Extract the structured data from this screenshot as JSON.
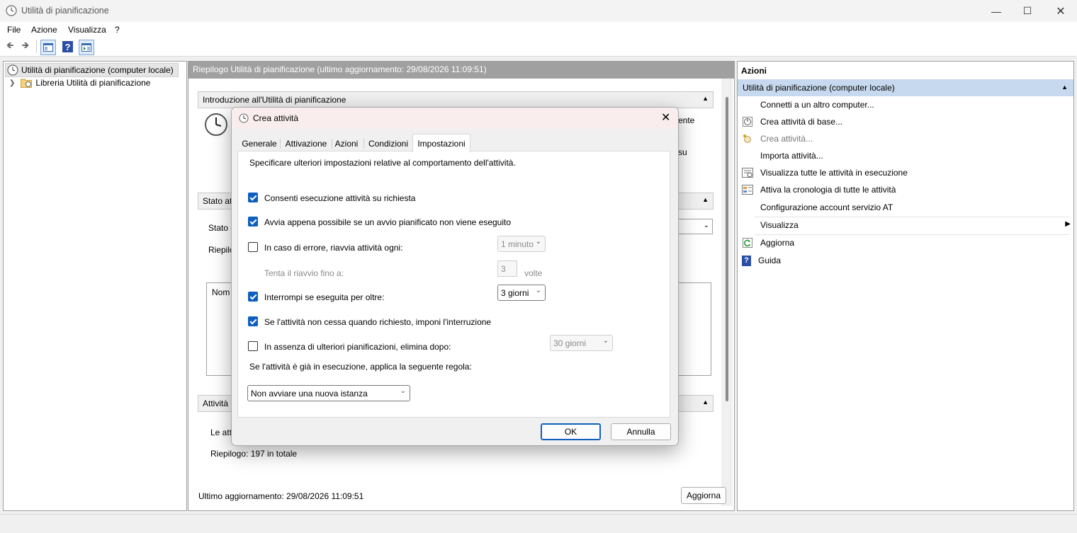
{
  "window": {
    "title": "Utilità di pianificazione"
  },
  "menu": [
    "File",
    "Azione",
    "Visualizza",
    "?"
  ],
  "tree": [
    {
      "label": "Utilità di pianificazione (computer locale)"
    },
    {
      "label": "Libreria Utilità di pianificazione"
    }
  ],
  "center": {
    "header": "Riepilogo Utilità di pianificazione (ultimo aggiornamento: 29/08/2026 11:09:51)",
    "intro_title": "Introduzione all'Utilità di pianificazione",
    "intro_text_fragment1": "ente",
    "intro_text_fragment2": "su",
    "stato_title": "Stato at",
    "stato_label": "Stato d",
    "riepilogo_label": "Riepilo",
    "nome_col": "Nom",
    "attivita_title": "Attività",
    "attivita_text": "Le att",
    "summary": "Riepilogo: 197 in totale",
    "last_update": "Ultimo aggiornamento: 29/08/2026 11:09:51",
    "refresh_button": "Aggiorna"
  },
  "actions_pane": {
    "title": "Azioni",
    "group": "Utilità di pianificazione (computer locale)",
    "items": [
      {
        "label": "Connetti a un altro computer...",
        "icon": "none"
      },
      {
        "label": "Crea attività di base...",
        "icon": "clock-icon"
      },
      {
        "label": "Crea attività...",
        "icon": "new-task-icon"
      },
      {
        "label": "Importa attività...",
        "icon": "none"
      },
      {
        "label": "Visualizza tutte le attività in esecuzione",
        "icon": "running-tasks-icon"
      },
      {
        "label": "Attiva la cronologia di tutte le attività",
        "icon": "history-icon"
      },
      {
        "label": "Configurazione account servizio AT",
        "icon": "none"
      },
      {
        "label": "Visualizza",
        "icon": "none"
      },
      {
        "label": "Aggiorna",
        "icon": "refresh-icon"
      },
      {
        "label": "Guida",
        "icon": "help-icon"
      }
    ]
  },
  "dialog": {
    "title": "Crea attività",
    "tabs": [
      "Generale",
      "Attivazione",
      "Azioni",
      "Condizioni",
      "Impostazioni"
    ],
    "active_tab": "Impostazioni",
    "description": "Specificare ulteriori impostazioni relative al comportamento dell'attività.",
    "allow_on_demand": {
      "label": "Consenti esecuzione attività su richiesta",
      "checked": true
    },
    "run_asap": {
      "label": "Avvia appena possibile se un avvio pianificato non viene eseguito",
      "checked": true
    },
    "restart_on_fail": {
      "label": "In caso di errore, riavvia attività ogni:",
      "checked": false,
      "value": "1 minuto"
    },
    "restart_attempts": {
      "label": "Tenta il riavvio fino a:",
      "value": "3",
      "unit": "volte"
    },
    "stop_if_longer": {
      "label": "Interrompi se eseguita per oltre:",
      "checked": true,
      "value": "3 giorni"
    },
    "force_stop": {
      "label": "Se l'attività non cessa quando richiesto, imponi l'interruzione",
      "checked": true
    },
    "delete_after": {
      "label": "In assenza di ulteriori pianificazioni, elimina dopo:",
      "checked": false,
      "value": "30 giorni"
    },
    "rule_label": "Se l'attività è già in esecuzione, applica la seguente regola:",
    "rule_value": "Non avviare una nuova istanza",
    "ok": "OK",
    "cancel": "Annulla"
  },
  "colors": {
    "accent": "#0f5fc0",
    "selected_header": "#c7d9ef",
    "pane_header": "#a0a0a0"
  }
}
